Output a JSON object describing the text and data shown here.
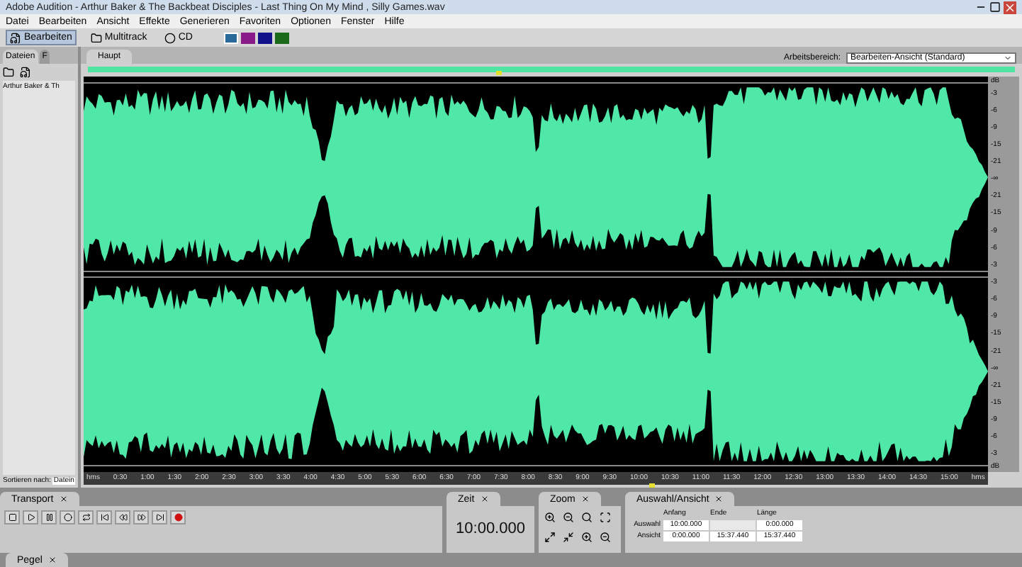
{
  "window": {
    "title": "Adobe Audition - Arthur Baker & The Backbeat Disciples - Last Thing On My Mind , Silly Games.wav"
  },
  "menu": [
    "Datei",
    "Bearbeiten",
    "Ansicht",
    "Effekte",
    "Generieren",
    "Favoriten",
    "Optionen",
    "Fenster",
    "Hilfe"
  ],
  "toolbar": {
    "modes": [
      {
        "label": "Bearbeiten",
        "selected": true
      },
      {
        "label": "Multitrack",
        "selected": false
      },
      {
        "label": "CD",
        "selected": false
      }
    ],
    "workspace_label": "Arbeitsbereich:",
    "workspace_value": "Bearbeiten-Ansicht (Standard)"
  },
  "files_panel": {
    "tabs": [
      {
        "label": "Dateien",
        "selected": true
      },
      {
        "label": "F",
        "selected": false
      }
    ],
    "items": [
      "Arthur Baker & Th"
    ],
    "sort_label": "Sortieren nach:",
    "sort_value": "Datein"
  },
  "editor": {
    "tab": "Haupt",
    "channels": [
      {
        "scale": [
          "-3",
          "-6",
          "-9",
          "-15",
          "-21",
          "-∞",
          "-21",
          "-15",
          "-9",
          "-6",
          "-3"
        ]
      },
      {
        "scale": [
          "-3",
          "-6",
          "-9",
          "-15",
          "-21",
          "-∞",
          "-21",
          "-15",
          "-9",
          "-6",
          "-3"
        ]
      }
    ],
    "scale_top": "dB",
    "scale_bottom": "dB",
    "ruler": [
      "hms",
      "0:30",
      "1:00",
      "1:30",
      "2:00",
      "2:30",
      "3:00",
      "3:30",
      "4:00",
      "4:30",
      "5:00",
      "5:30",
      "6:00",
      "6:30",
      "7:00",
      "7:30",
      "8:00",
      "8:30",
      "9:00",
      "9:30",
      "10:00",
      "10:30",
      "11:00",
      "11:30",
      "12:00",
      "12:30",
      "13:00",
      "13:30",
      "14:00",
      "14:30",
      "15:00",
      "hms"
    ]
  },
  "transport": {
    "tab": "Transport"
  },
  "time": {
    "tab": "Zeit",
    "value": "10:00.000"
  },
  "zoom": {
    "tab": "Zoom"
  },
  "selection": {
    "tab": "Auswahl/Ansicht",
    "columns": [
      "Anfang",
      "Ende",
      "Länge"
    ],
    "rows": [
      {
        "label": "Auswahl",
        "fields": [
          {
            "value": "10:00.000"
          },
          {
            "blank": true
          },
          {
            "value": "0:00.000"
          }
        ]
      },
      {
        "label": "Ansicht",
        "fields": [
          {
            "value": "0:00.000"
          },
          {
            "value": "15:37.440"
          },
          {
            "value": "15:37.440"
          }
        ]
      }
    ]
  },
  "level_panel": {
    "tab": "Pegel"
  }
}
